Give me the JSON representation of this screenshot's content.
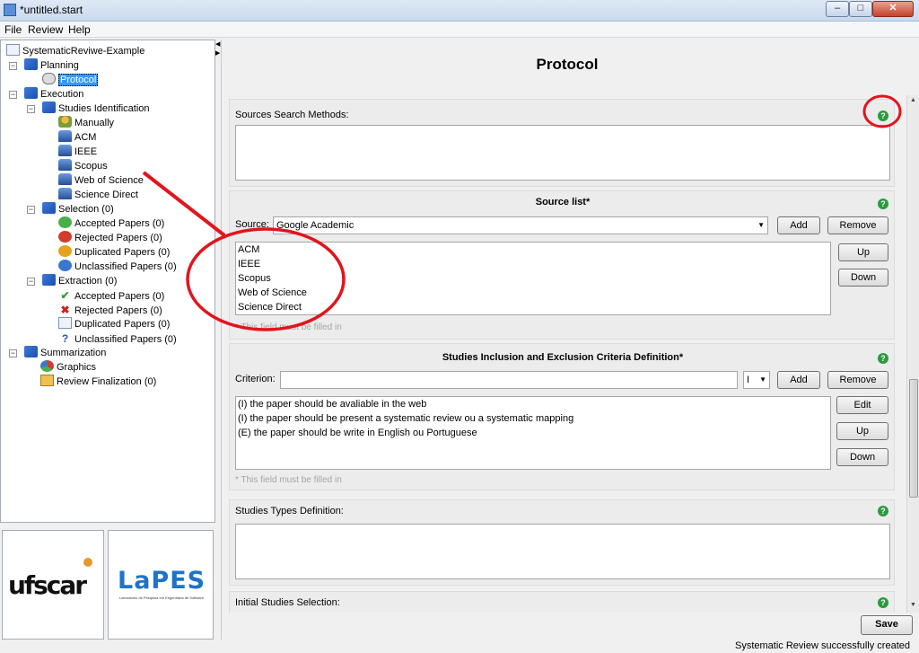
{
  "window": {
    "title": "*untitled.start",
    "min_glyph": "–",
    "max_glyph": "□",
    "close_glyph": "✕"
  },
  "menu": {
    "items": [
      "File",
      "Review",
      "Help"
    ]
  },
  "tree": {
    "root": "SystematicReviwe-Example",
    "planning": "Planning",
    "protocol": "Protocol",
    "execution": "Execution",
    "studies_identification": "Studies Identification",
    "manually": "Manually",
    "acm": "ACM",
    "ieee": "IEEE",
    "scopus": "Scopus",
    "web_of_science": "Web of Science",
    "science_direct": "Science Direct",
    "selection": "Selection (0)",
    "sel_accepted": "Accepted Papers (0)",
    "sel_rejected": "Rejected Papers (0)",
    "sel_duplicated": "Duplicated Papers (0)",
    "sel_unclassified": "Unclassified Papers (0)",
    "extraction": "Extraction (0)",
    "ext_accepted": "Accepted Papers (0)",
    "ext_rejected": "Rejected Papers (0)",
    "ext_duplicated": "Duplicated Papers (0)",
    "ext_unclassified": "Unclassified Papers (0)",
    "summarization": "Summarization",
    "graphics": "Graphics",
    "review_finalization": "Review Finalization (0)"
  },
  "logos": {
    "ufscar": "ufscar",
    "lapes": "LaPES",
    "lapes_sub": "Laboratório de Pesquisa em Engenharia de Software"
  },
  "content": {
    "title": "Protocol",
    "sources_search_methods": {
      "label": "Sources Search Methods:"
    },
    "source_list": {
      "heading": "Source list*",
      "source_label": "Source:",
      "selected_source": "Google Academic",
      "add": "Add",
      "remove": "Remove",
      "up": "Up",
      "down": "Down",
      "items": [
        "ACM",
        "IEEE",
        "Scopus",
        "Web of Science",
        "Science Direct"
      ],
      "hint": "* This field must be filled in"
    },
    "criteria": {
      "heading": "Studies Inclusion and Exclusion Criteria Definition*",
      "criterion_label": "Criterion:",
      "criterion_value": "",
      "type_value": "I",
      "add": "Add",
      "remove": "Remove",
      "edit": "Edit",
      "up": "Up",
      "down": "Down",
      "items": [
        "(I) the paper should be avaliable in the web",
        "(I) the paper should be present a systematic review ou a systematic mapping",
        "(E) the paper should be write in English ou Portuguese"
      ],
      "hint": "* This field must be filled in"
    },
    "studies_types": {
      "label": "Studies Types Definition:"
    },
    "initial_selection": {
      "label": "Initial Studies Selection:"
    },
    "help_glyph": "?",
    "save": "Save"
  },
  "status": {
    "message": "Systematic Review successfully created"
  },
  "colors": {
    "annotation_red": "#e3141d",
    "help_green": "#2a9b3e",
    "tree_selection": "#3399ff"
  }
}
